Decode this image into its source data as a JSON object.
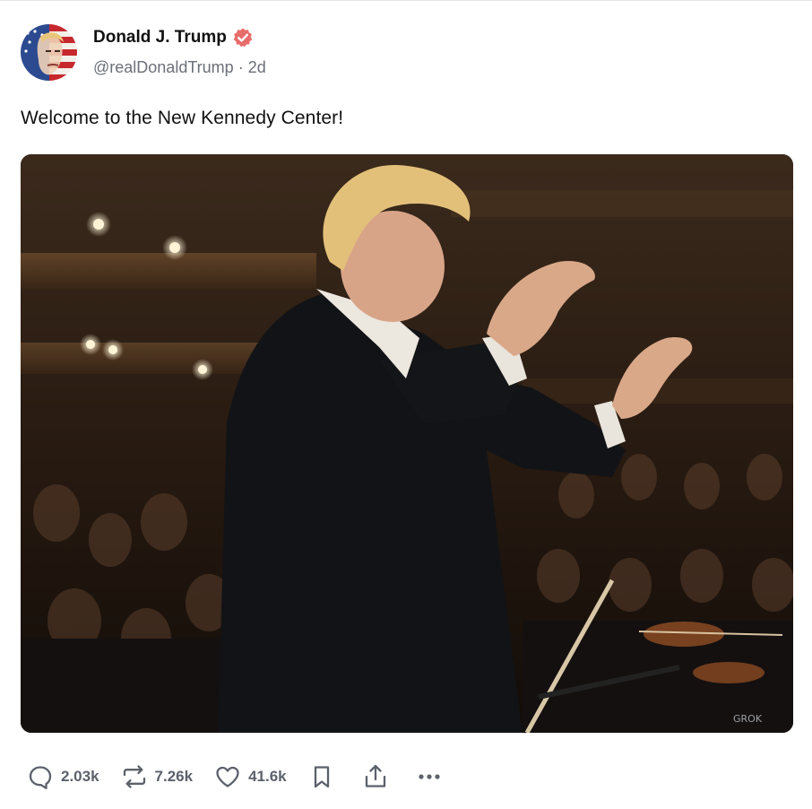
{
  "post": {
    "author": {
      "display_name": "Donald J. Trump",
      "handle": "@realDonaldTrump",
      "separator": "·",
      "time_ago": "2d",
      "verified": true,
      "badge_color": "#e86c6a",
      "avatar_icon": "stylized-flag-portrait-avatar"
    },
    "text": "Welcome to the New Kennedy Center!",
    "media": {
      "description_icon": "conductor-orchestra-photo",
      "watermark": "GROK"
    },
    "actions": {
      "replies": "2.03k",
      "reposts": "7.26k",
      "likes": "41.6k",
      "bookmark_icon": "bookmark-icon",
      "share_icon": "share-icon",
      "more_icon": "more-options-icon"
    }
  },
  "colors": {
    "text_primary": "#111111",
    "text_secondary": "#6b7078",
    "action_gray": "#5c616a"
  }
}
